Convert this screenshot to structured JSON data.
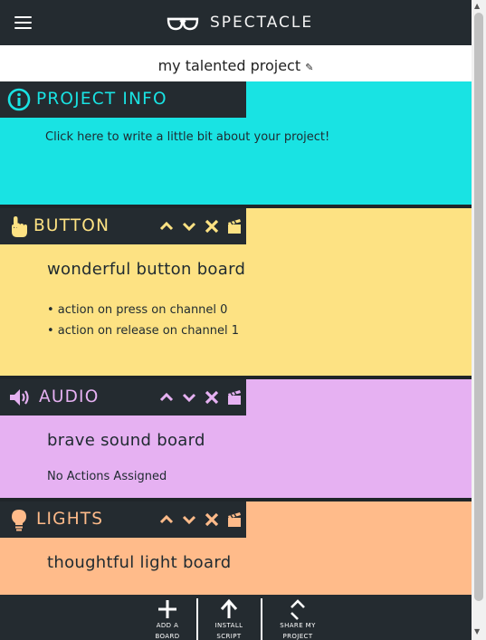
{
  "app": {
    "title": "SPECTACLE",
    "project_name": "my talented project",
    "edit_glyph": "✎"
  },
  "info": {
    "label": "PROJECT INFO",
    "prompt": "Click here to write a little bit about your project!",
    "bg": "#19e3e3",
    "accent": "#19e3e3",
    "icon": "info-icon"
  },
  "boards": [
    {
      "label": "BUTTON",
      "title": "wonderful button board",
      "actions": [
        "• action on press on channel 0",
        "• action on release on channel 1"
      ],
      "bg": "#fde283",
      "accent": "#fde283",
      "icon": "hand-pointer-icon"
    },
    {
      "label": "AUDIO",
      "title": "brave sound board",
      "empty": "No Actions Assigned",
      "bg": "#e6b1f2",
      "accent": "#e6b1f2",
      "icon": "speaker-icon"
    },
    {
      "label": "LIGHTS",
      "title": "thoughtful light board",
      "bg": "#ffbb8a",
      "accent": "#ffbb8a",
      "icon": "lightbulb-icon"
    }
  ],
  "footer": {
    "add": [
      "ADD A",
      "BOARD"
    ],
    "install": [
      "INSTALL",
      "SCRIPT"
    ],
    "share": [
      "SHARE MY",
      "PROJECT"
    ]
  }
}
